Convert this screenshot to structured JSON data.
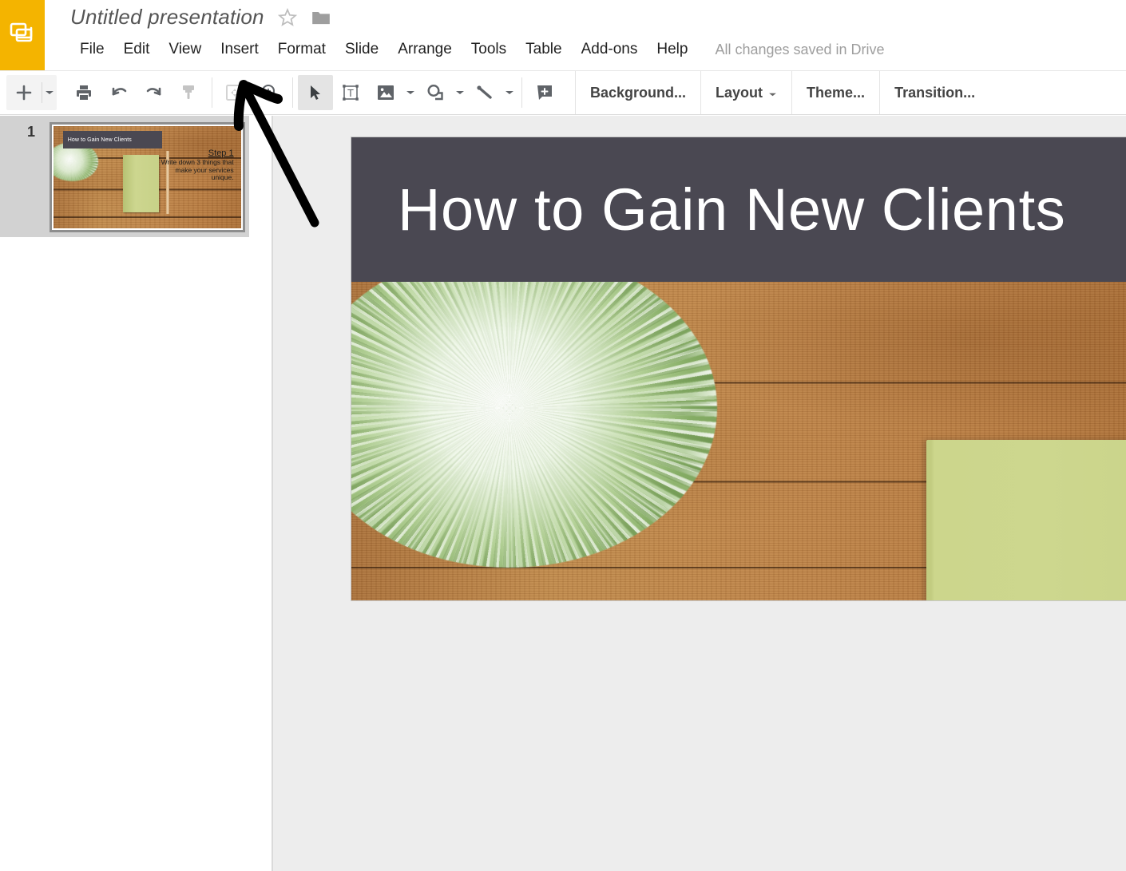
{
  "app": {
    "name": "Google Slides",
    "logo_icon": "slides-logo-icon",
    "logo_color": "#f4b400"
  },
  "header": {
    "doc_title": "Untitled presentation",
    "star_icon": "star-outline-icon",
    "folder_icon": "move-to-folder-icon",
    "save_status": "All changes saved in Drive",
    "menu_items": [
      {
        "label": "File"
      },
      {
        "label": "Edit"
      },
      {
        "label": "View"
      },
      {
        "label": "Insert"
      },
      {
        "label": "Format"
      },
      {
        "label": "Slide"
      },
      {
        "label": "Arrange"
      },
      {
        "label": "Tools"
      },
      {
        "label": "Table"
      },
      {
        "label": "Add-ons"
      },
      {
        "label": "Help"
      }
    ]
  },
  "toolbar": {
    "new_slide_icon": "plus-icon",
    "new_slide_caret_icon": "chevron-down-icon",
    "print_icon": "print-icon",
    "undo_icon": "undo-icon",
    "redo_icon": "redo-icon",
    "paint_format_icon": "paint-format-icon",
    "fit_icon": "fit-to-screen-icon",
    "zoom_icon": "zoom-in-icon",
    "select_icon": "select-arrow-icon",
    "textbox_icon": "text-box-icon",
    "image_icon": "insert-image-icon",
    "image_caret_icon": "chevron-down-icon",
    "shape_icon": "insert-shape-icon",
    "shape_caret_icon": "chevron-down-icon",
    "line_icon": "insert-line-icon",
    "line_caret_icon": "chevron-down-icon",
    "comment_icon": "add-comment-icon",
    "background_label": "Background...",
    "layout_label": "Layout",
    "layout_caret_icon": "chevron-down-icon",
    "theme_label": "Theme...",
    "transition_label": "Transition..."
  },
  "filmstrip": {
    "slides": [
      {
        "number": "1",
        "title": "How to Gain New Clients",
        "step_heading": "Step 1",
        "step_body": "Write down 3 things that make your services unique.",
        "selected": true
      }
    ]
  },
  "slide": {
    "title": "How to Gain New Clients",
    "header_color": "#4a4852",
    "title_color": "#ffffff",
    "image_description": "wooden desk with potted grass plant, green notebook and pencil",
    "wood_color": "#b87b41",
    "notebook_color": "#ccd68c",
    "plant_color": "#8ab066"
  },
  "annotation": {
    "arrow_icon": "pointer-arrow-annotation",
    "color": "#000000",
    "points_to": "paint-format-icon"
  }
}
